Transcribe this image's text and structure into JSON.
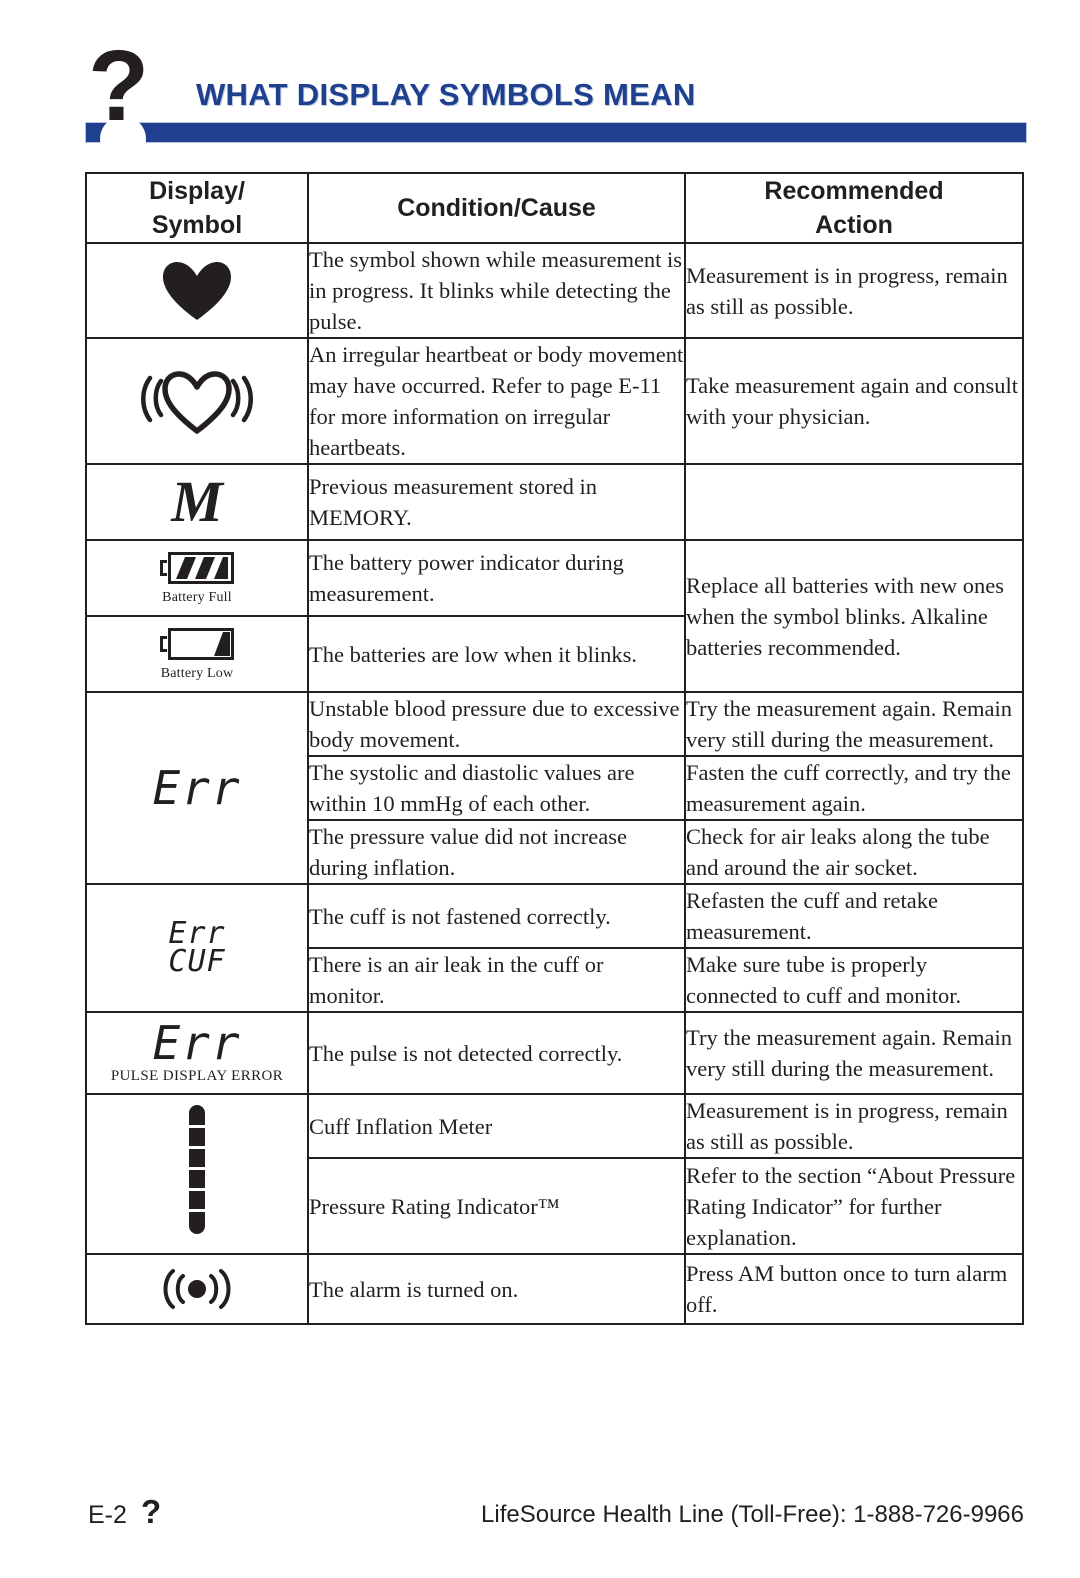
{
  "header": {
    "icon": "question-mark-icon",
    "title": "WHAT DISPLAY SYMBOLS MEAN",
    "bar_color": "#1f3f8f",
    "title_color": "#1f3f8f"
  },
  "table": {
    "columns": [
      "Display/ Symbol",
      "Condition/Cause",
      "Recommended Action"
    ],
    "headers": {
      "display_symbol_line1": "Display/",
      "display_symbol_line2": "Symbol",
      "condition_cause": "Condition/Cause",
      "recommended_line1": "Recommended",
      "recommended_line2": "Action"
    },
    "rows": [
      {
        "symbol": "filled-heart-icon",
        "symbol_text": "",
        "caption": "",
        "condition": "The symbol shown while measurement is in progress. It blinks while detecting the pulse.",
        "action": "Measurement is in progress, remain as still as possible."
      },
      {
        "symbol": "irregular-heartbeat-icon",
        "symbol_text": "",
        "caption": "",
        "condition": "An irregular heartbeat or body movement may have occurred. Refer to page E-11 for more information on irregular heartbeats.",
        "action": "Take measurement again and consult with your physician."
      },
      {
        "symbol": "memory-m-icon",
        "symbol_text": "M",
        "caption": "",
        "condition": "Previous measurement stored in MEMORY.",
        "action": ""
      },
      {
        "symbol": "battery-full-icon",
        "symbol_text": "",
        "caption": "Battery Full",
        "condition": "The battery power indicator during measurement.",
        "action": "Replace all batteries with new ones when the symbol blinks. Alkaline batteries recommended."
      },
      {
        "symbol": "battery-low-icon",
        "symbol_text": "",
        "caption": "Battery Low",
        "condition": "The batteries are low when it blinks.",
        "action": ""
      },
      {
        "symbol": "err-lcd-icon",
        "symbol_text": "Err",
        "caption": "",
        "condition": "Unstable blood pressure due to excessive body movement.",
        "action": "Try the measurement again. Remain very still during the measurement."
      },
      {
        "symbol": "",
        "symbol_text": "",
        "caption": "",
        "condition": "The systolic and diastolic values are within 10 mmHg of each other.",
        "action": "Fasten the cuff correctly, and try the measurement again."
      },
      {
        "symbol": "",
        "symbol_text": "",
        "caption": "",
        "condition": "The pressure value did not increase during inflation.",
        "action": "Check for air leaks along the tube and around the air socket."
      },
      {
        "symbol": "err-cuf-lcd-icon",
        "symbol_text_line1": "Err",
        "symbol_text_line2": "CUF",
        "caption": "",
        "condition": "The cuff is not fastened correctly.",
        "action": "Refasten the cuff and retake measurement."
      },
      {
        "symbol": "",
        "symbol_text": "",
        "caption": "",
        "condition": "There is an air leak in the cuff or monitor.",
        "action": "Make sure tube is properly connected to cuff and monitor."
      },
      {
        "symbol": "err-pulse-lcd-icon",
        "symbol_text": "Err",
        "caption": "PULSE DISPLAY ERROR",
        "condition": "The pulse is not detected correctly.",
        "action": "Try the measurement again. Remain very still during the measurement."
      },
      {
        "symbol": "cuff-inflation-meter-icon",
        "symbol_text": "",
        "caption": "",
        "condition": "Cuff Inflation Meter",
        "action": "Measurement is in progress, remain as still as possible."
      },
      {
        "symbol": "",
        "symbol_text": "",
        "caption": "",
        "condition": "Pressure Rating Indicator™",
        "action": "Refer to the section “About Pressure Rating Indicator” for further explanation."
      },
      {
        "symbol": "alarm-on-icon",
        "symbol_text": "",
        "caption": "",
        "condition": "The alarm is turned on.",
        "action": "Press AM button once to turn alarm off."
      }
    ]
  },
  "footer": {
    "page_number": "E-2",
    "page_icon": "question-mark-icon",
    "contact": "LifeSource Health Line (Toll-Free): 1-888-726-9966"
  }
}
